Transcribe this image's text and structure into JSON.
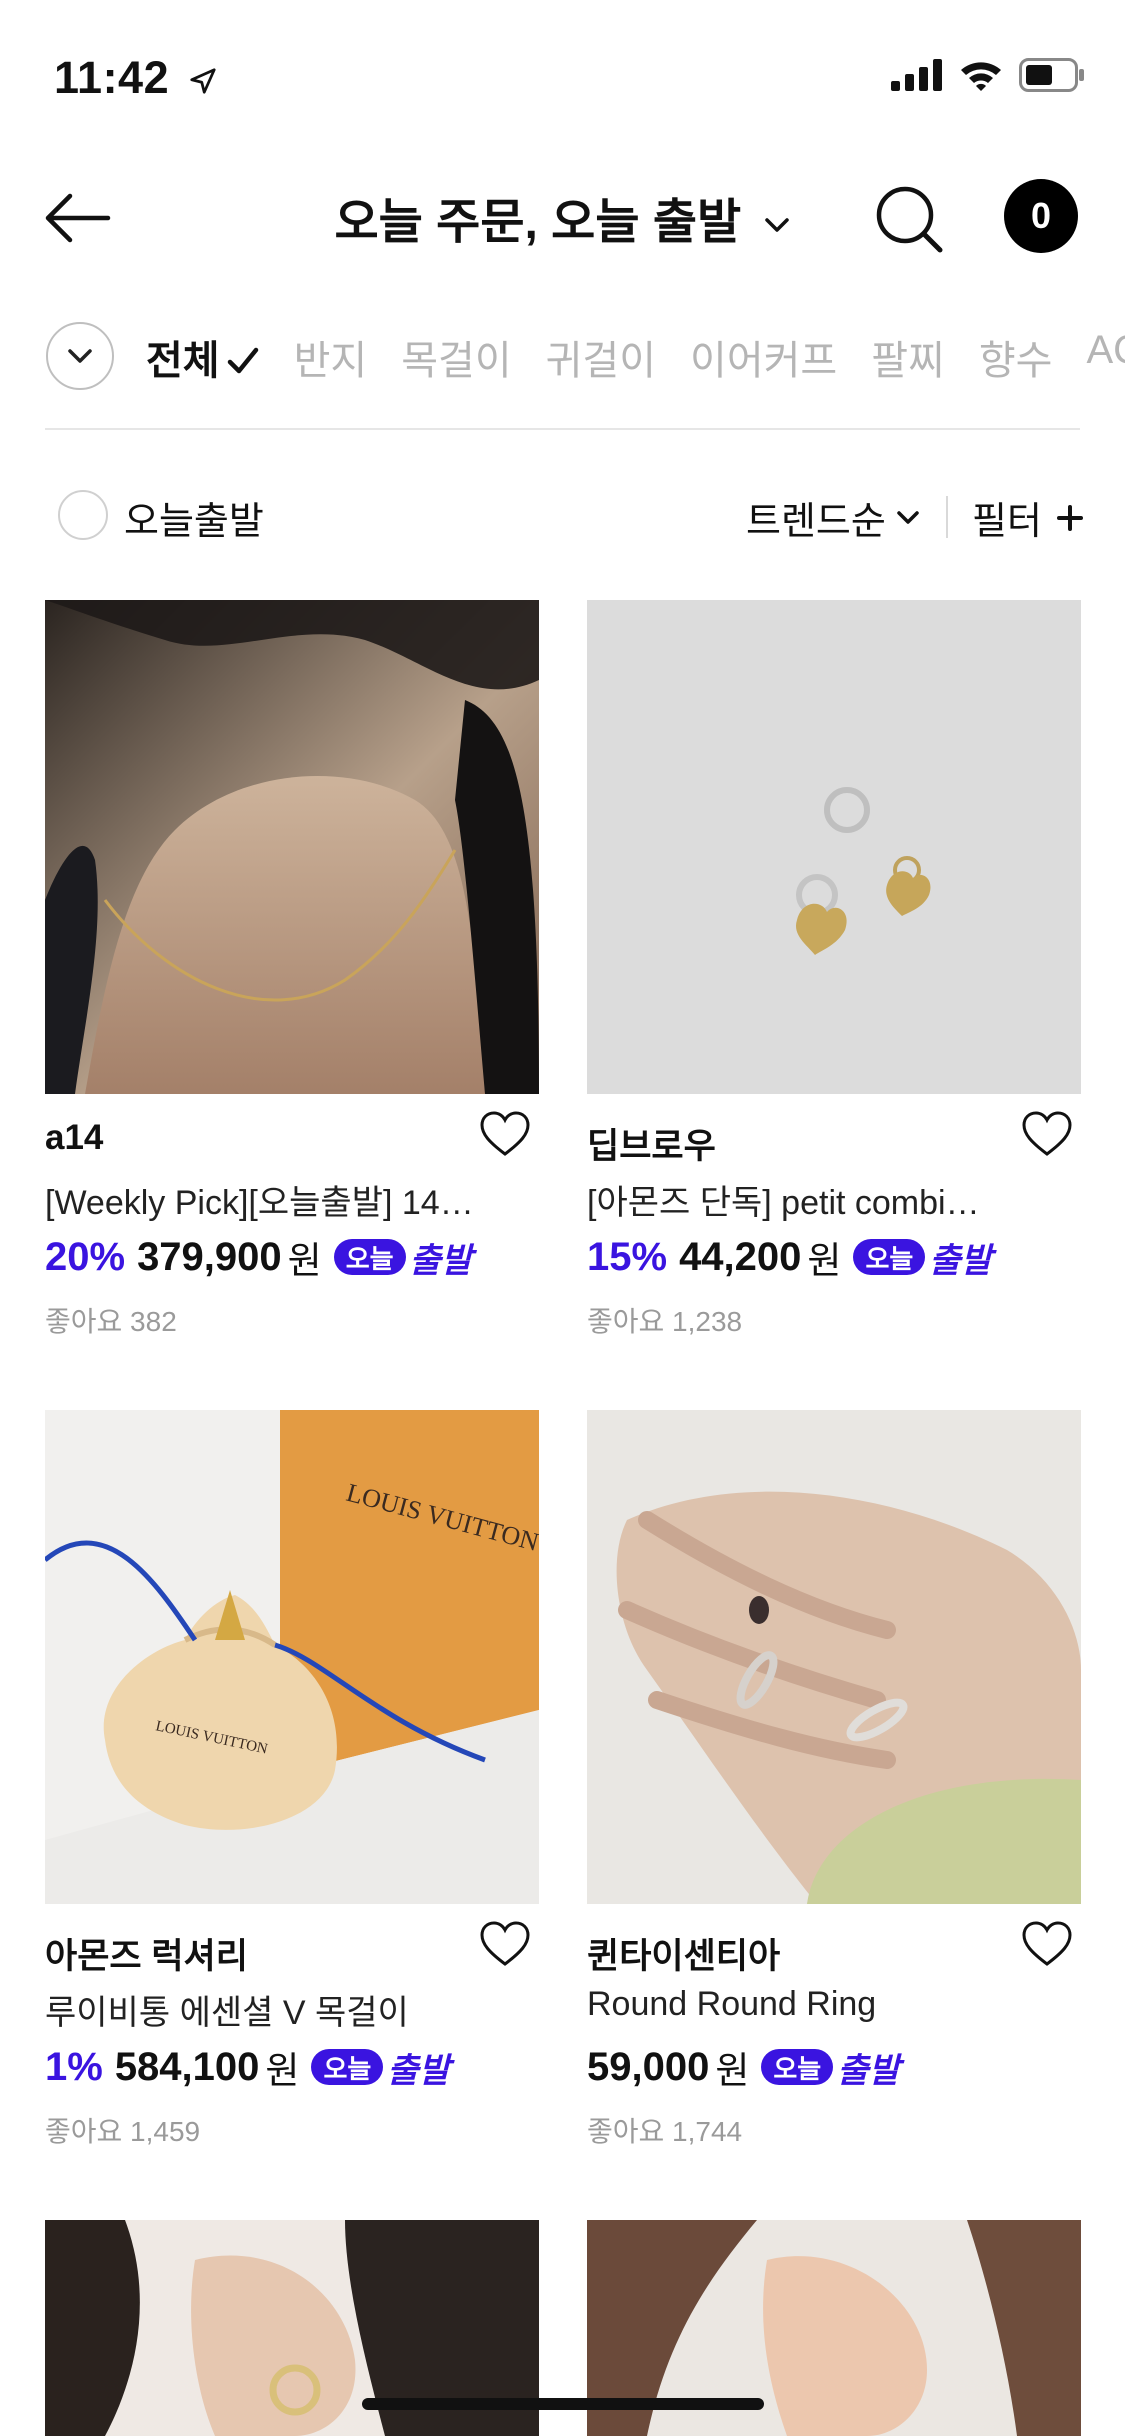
{
  "status_bar": {
    "time": "11:42"
  },
  "header": {
    "title": "오늘 주문, 오늘 출발",
    "cart_count": "0"
  },
  "category_tabs": [
    {
      "label": "전체",
      "active": true
    },
    {
      "label": "반지",
      "active": false
    },
    {
      "label": "목걸이",
      "active": false
    },
    {
      "label": "귀걸이",
      "active": false
    },
    {
      "label": "이어커프",
      "active": false
    },
    {
      "label": "팔찌",
      "active": false
    },
    {
      "label": "향수",
      "active": false
    },
    {
      "label": "ACC",
      "active": false
    }
  ],
  "filters": {
    "today_label": "오늘출발",
    "sort_label": "트렌드순",
    "filter_label": "필터"
  },
  "products": [
    {
      "brand": "a14",
      "title": "[Weekly Pick][오늘출발] 14…",
      "discount": "20%",
      "price": "379,900",
      "unit": "원",
      "badge_today": "오늘",
      "badge_departure": "출발",
      "likes": "좋아요 382"
    },
    {
      "brand": "딥브로우",
      "title": "[아몬즈 단독] petit combi…",
      "discount": "15%",
      "price": "44,200",
      "unit": "원",
      "badge_today": "오늘",
      "badge_departure": "출발",
      "likes": "좋아요 1,238"
    },
    {
      "brand": "아몬즈 럭셔리",
      "title": "루이비통 에센셜 V 목걸이",
      "discount": "1%",
      "price": "584,100",
      "unit": "원",
      "badge_today": "오늘",
      "badge_departure": "출발",
      "likes": "좋아요 1,459",
      "image_text": "LOUIS VUITTON"
    },
    {
      "brand": "퀸타이센티아",
      "title": "Round Round Ring",
      "discount": "",
      "price": "59,000",
      "unit": "원",
      "badge_today": "오늘",
      "badge_departure": "출발",
      "likes": "좋아요 1,744"
    }
  ],
  "colors": {
    "accent": "#3a14e0",
    "text": "#111111",
    "muted": "#9a9a9a"
  },
  "icons": [
    "back-arrow-icon",
    "chevron-down-icon",
    "search-icon",
    "check-icon",
    "heart-icon",
    "plus-icon",
    "signal-icon",
    "wifi-icon",
    "battery-icon",
    "location-arrow-icon"
  ]
}
